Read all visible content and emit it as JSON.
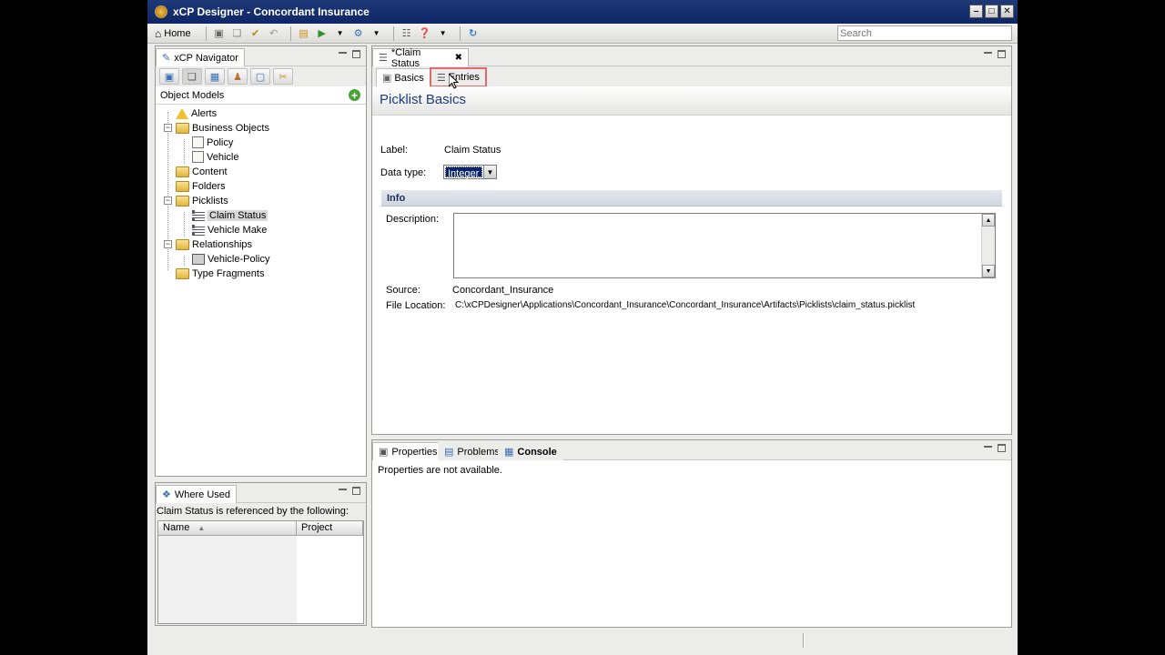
{
  "window": {
    "title": "xCP Designer - Concordant Insurance"
  },
  "toolbar": {
    "home_label": "Home",
    "search_placeholder": "Search"
  },
  "navigator": {
    "tab_label": "xCP Navigator",
    "section_label": "Object Models",
    "tree": {
      "alerts": "Alerts",
      "business_objects": "Business Objects",
      "policy": "Policy",
      "vehicle": "Vehicle",
      "content": "Content",
      "folders": "Folders",
      "picklists": "Picklists",
      "claim_status": "Claim Status",
      "vehicle_make": "Vehicle Make",
      "relationships": "Relationships",
      "vehicle_policy": "Vehicle-Policy",
      "type_fragments": "Type Fragments"
    }
  },
  "where_used": {
    "tab_label": "Where Used",
    "description": "Claim Status is referenced by the following:",
    "columns": {
      "name": "Name",
      "project": "Project"
    }
  },
  "editor": {
    "tab_label": "*Claim Status",
    "subtabs": {
      "basics": "Basics",
      "entries": "Entries"
    },
    "header_title": "Picklist Basics",
    "label_label": "Label:",
    "label_value": "Claim Status",
    "data_type_label": "Data type:",
    "data_type_value": "Integer",
    "info_title": "Info",
    "description_label": "Description:",
    "source_label": "Source:",
    "source_value": "Concordant_Insurance",
    "file_location_label": "File Location:",
    "file_location_value": "C:\\xCPDesigner\\Applications\\Concordant_Insurance\\Concordant_Insurance\\Artifacts\\Picklists\\claim_status.picklist"
  },
  "bottom_panel": {
    "tabs": {
      "properties": "Properties",
      "problems": "Problems",
      "console": "Console"
    },
    "message": "Properties are not available."
  },
  "colors": {
    "title_bar": "#0d2766",
    "header_text": "#1d3d77",
    "focus_highlight": "#e3686b",
    "selection": "#0a246a"
  }
}
